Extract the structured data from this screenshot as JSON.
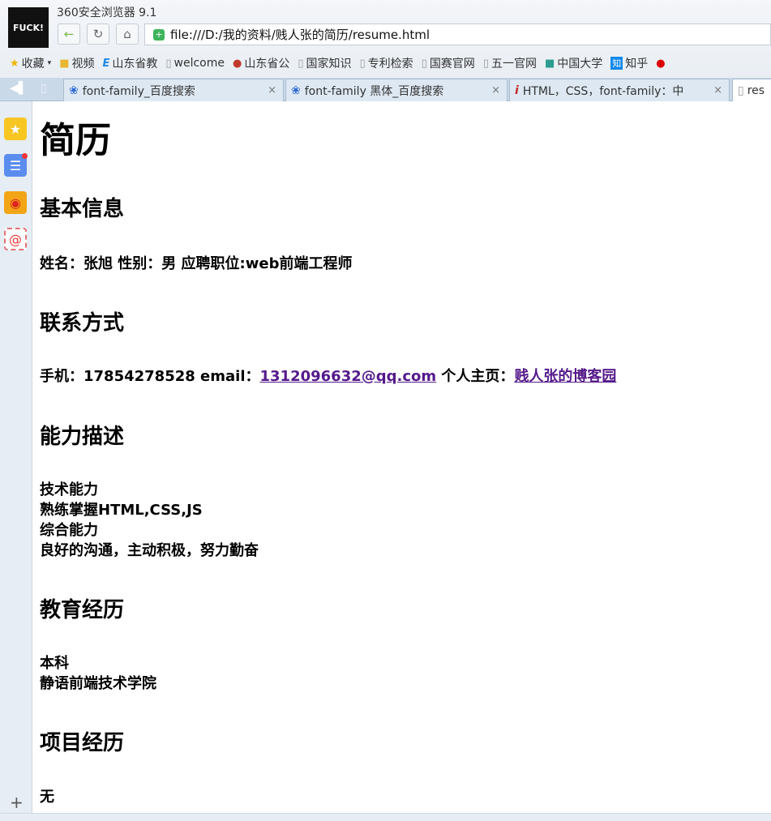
{
  "app_title": "360安全浏览器 9.1",
  "logo_text": "FUCK!",
  "url": "file:///D:/我的资料/贱人张的简历/resume.html",
  "bookmarks": [
    "收藏",
    "视频",
    "山东省教",
    "welcome",
    "山东省公",
    "国家知识",
    "专利检索",
    "国赛官网",
    "五一官网",
    "中国大学",
    "知乎"
  ],
  "tabs": [
    {
      "label": "font-family_百度搜索"
    },
    {
      "label": "font-family 黑体_百度搜索"
    },
    {
      "label": "HTML，CSS，font-family：中"
    },
    {
      "label": "res"
    }
  ],
  "page": {
    "title": "简历",
    "basic_heading": "基本信息",
    "basic_text": "姓名：张旭 性别：男 应聘职位:web前端工程师",
    "contact_heading": "联系方式",
    "contact_prefix": "手机：17854278528 email：",
    "email": "1312096632@qq.com",
    "homepage_label": " 个人主页：",
    "homepage_link": "贱人张的博客园",
    "ability_heading": "能力描述",
    "ability_lines": [
      "技术能力",
      "熟练掌握HTML,CSS,JS",
      "综合能力",
      "良好的沟通，主动积极，努力勤奋"
    ],
    "edu_heading": "教育经历",
    "edu_lines": [
      "本科",
      "静语前端技术学院"
    ],
    "project_heading": "项目经历",
    "project_text": "无"
  }
}
